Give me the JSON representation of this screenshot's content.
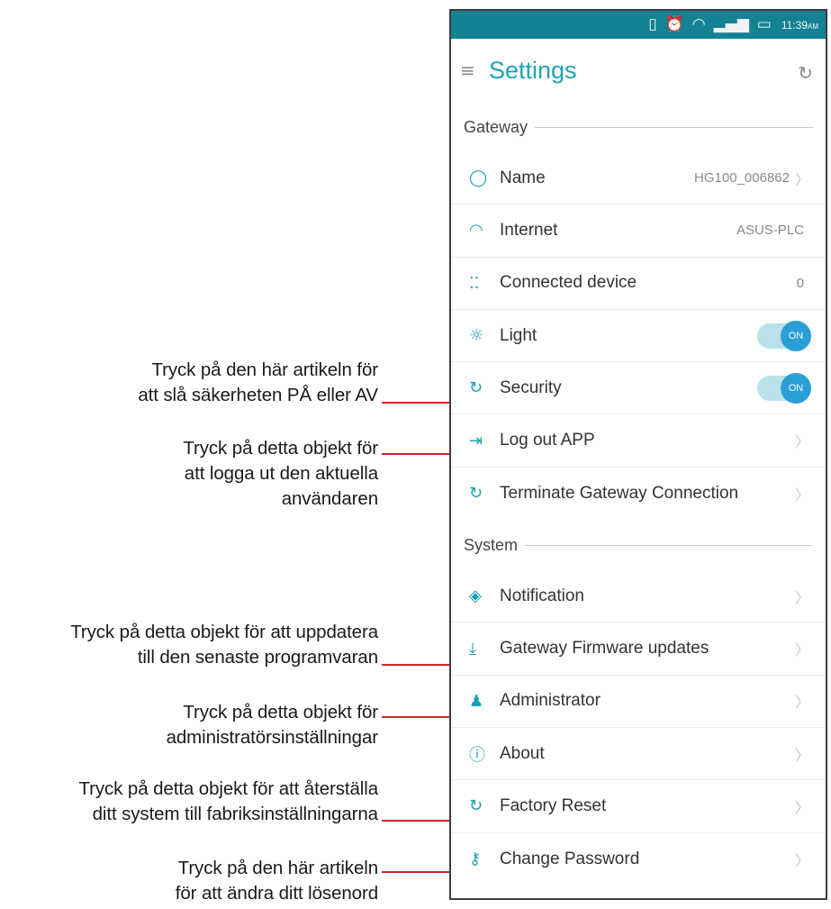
{
  "statusbar": {
    "icons": [
      "vibrate-icon",
      "alarm-icon",
      "wifi-icon",
      "signal-icon",
      "battery-icon"
    ],
    "time": "11:39",
    "ampm": "AM"
  },
  "appbar": {
    "title": "Settings"
  },
  "sections": {
    "gateway": "Gateway",
    "system": "System"
  },
  "items": {
    "name": {
      "label": "Name",
      "value": "HG100_006862"
    },
    "internet": {
      "label": "Internet",
      "value": "ASUS-PLC"
    },
    "connected": {
      "label": "Connected device",
      "value": "0"
    },
    "light": {
      "label": "Light",
      "toggle": "ON"
    },
    "security": {
      "label": "Security",
      "toggle": "ON"
    },
    "logout": {
      "label": "Log out APP"
    },
    "terminate": {
      "label": "Terminate Gateway Connection"
    },
    "notification": {
      "label": "Notification"
    },
    "firmware": {
      "label": "Gateway Firmware updates"
    },
    "administrator": {
      "label": "Administrator"
    },
    "about": {
      "label": "About"
    },
    "factory": {
      "label": "Factory Reset"
    },
    "password": {
      "label": "Change Password"
    }
  },
  "annotations": {
    "security": [
      "Tryck på den här artikeln för",
      "att slå säkerheten PÅ eller AV"
    ],
    "logout": [
      "Tryck på detta objekt för",
      "att logga ut den aktuella",
      "användaren"
    ],
    "firmware": [
      "Tryck på detta objekt för att uppdatera",
      "till den senaste programvaran"
    ],
    "administrator": [
      "Tryck på detta objekt för",
      "administratörsinställningar"
    ],
    "factory": [
      "Tryck på detta objekt för att återställa",
      "ditt system till fabriksinställningarna"
    ],
    "password": [
      "Tryck på den här artikeln",
      "för att ändra ditt lösenord"
    ]
  },
  "colors": {
    "accent": "#1fa3b5",
    "statusbar": "#138293",
    "leader": "#c8282e",
    "toggle": "#2a9fd6"
  }
}
